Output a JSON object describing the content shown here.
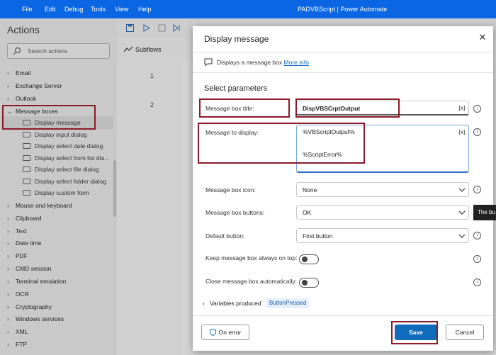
{
  "window": {
    "menu": [
      "File",
      "Edit",
      "Debug",
      "Tools",
      "View",
      "Help"
    ],
    "title": "PADVBScript | Power Automate"
  },
  "actions_panel": {
    "heading": "Actions",
    "search_placeholder": "Search actions",
    "categories": [
      "Email",
      "Exchange Server",
      "Outlook",
      "Message boxes",
      "Mouse and keyboard",
      "Clipboard",
      "Text",
      "Date time",
      "PDF",
      "CMD session",
      "Terminal emulation",
      "OCR",
      "Cryptography",
      "Windows services",
      "XML",
      "FTP"
    ],
    "message_box_items": [
      "Display message",
      "Display input dialog",
      "Display select date dialog",
      "Display select from list dia...",
      "Display select file dialog",
      "Display select folder dialog",
      "Display custom form"
    ]
  },
  "designer": {
    "subflows_label": "Subflows",
    "rows": [
      "1",
      "2"
    ]
  },
  "dialog": {
    "title": "Display message",
    "description": "Displays a message box",
    "more_info": "More info",
    "section": "Select parameters",
    "fields": {
      "title_label": "Message box title:",
      "title_value": "DispVBSCrptOutput",
      "message_label": "Message to display:",
      "message_line1": "%VBScriptOutput%",
      "message_line2": "%ScriptError%",
      "icon_label": "Message box icon:",
      "icon_value": "None",
      "buttons_label": "Message box buttons:",
      "buttons_value": "OK",
      "default_label": "Default button:",
      "default_value": "First button",
      "ontop_label": "Keep message box always on top:",
      "autoclose_label": "Close message box automatically:",
      "var_button": "{x}"
    },
    "variables_produced": "Variables produced",
    "variable_badge": "ButtonPressed",
    "on_error": "On error",
    "save": "Save",
    "cancel": "Cancel"
  },
  "tooltip_text": "The bu",
  "colors": {
    "titlebar": "#0b66e4",
    "primary": "#0f6cbd",
    "highlight": "#8b1a2b"
  }
}
